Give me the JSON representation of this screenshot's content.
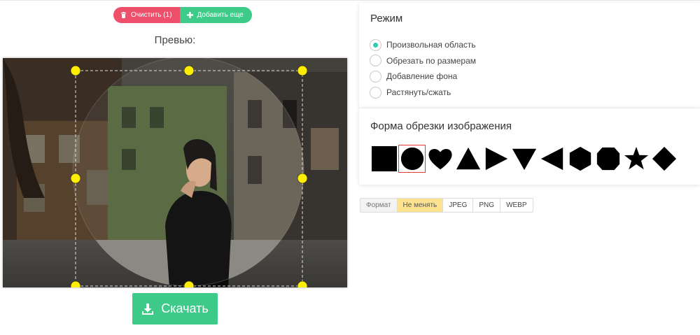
{
  "toolbar": {
    "clear_label": "Очистить (1)",
    "add_label": "Добавить еще"
  },
  "preview": {
    "title": "Превью:"
  },
  "download": {
    "label": "Скачать"
  },
  "mode": {
    "title": "Режим",
    "options": [
      {
        "label": "Произвольная область",
        "checked": true
      },
      {
        "label": "Обрезать по размерам",
        "checked": false
      },
      {
        "label": "Добавление фона",
        "checked": false
      },
      {
        "label": "Растянуть/сжать",
        "checked": false
      }
    ]
  },
  "shape": {
    "title": "Форма обрезки изображения",
    "items": [
      {
        "name": "square",
        "selected": false
      },
      {
        "name": "circle",
        "selected": true
      },
      {
        "name": "heart",
        "selected": false
      },
      {
        "name": "triangle-up",
        "selected": false
      },
      {
        "name": "triangle-right",
        "selected": false
      },
      {
        "name": "triangle-down",
        "selected": false
      },
      {
        "name": "triangle-left",
        "selected": false
      },
      {
        "name": "hexagon",
        "selected": false
      },
      {
        "name": "octagon",
        "selected": false
      },
      {
        "name": "star",
        "selected": false
      },
      {
        "name": "rhombus",
        "selected": false
      }
    ]
  },
  "format": {
    "label": "Формат",
    "options": [
      "Не менять",
      "JPEG",
      "PNG",
      "WEBP"
    ],
    "selected": "Не менять"
  },
  "colors": {
    "clear_button": "#ee4f6b",
    "accent_green": "#3ecb8a",
    "radio_checked": "#2bcfb0",
    "format_active": "#fde28f",
    "handle": "#ffee00",
    "selected_outline": "#e53935"
  }
}
